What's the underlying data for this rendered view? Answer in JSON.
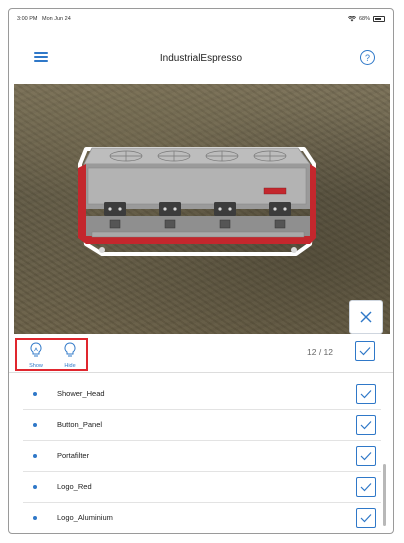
{
  "status_bar": {
    "time": "3:00 PM",
    "date": "Mon Jun 24",
    "battery": "68%"
  },
  "nav": {
    "title": "IndustrialEspresso",
    "help_label": "?"
  },
  "toolbar": {
    "show_label": "Show",
    "hide_label": "Hide",
    "counter": "12 / 12",
    "highlight_color": "#e0262e",
    "accent_color": "#2f78c8"
  },
  "parts": [
    {
      "label": "Shower_Head",
      "checked": true
    },
    {
      "label": "Button_Panel",
      "checked": true
    },
    {
      "label": "Portafilter",
      "checked": true
    },
    {
      "label": "Logo_Red",
      "checked": true
    },
    {
      "label": "Logo_Aluminium",
      "checked": true
    }
  ],
  "icons": {
    "menu": "hamburger-icon",
    "help": "help-icon",
    "close": "close-icon",
    "show": "lightbulb-on-icon",
    "hide": "lightbulb-off-icon",
    "check": "checkmark-icon",
    "wifi": "wifi-icon",
    "battery": "battery-icon"
  }
}
